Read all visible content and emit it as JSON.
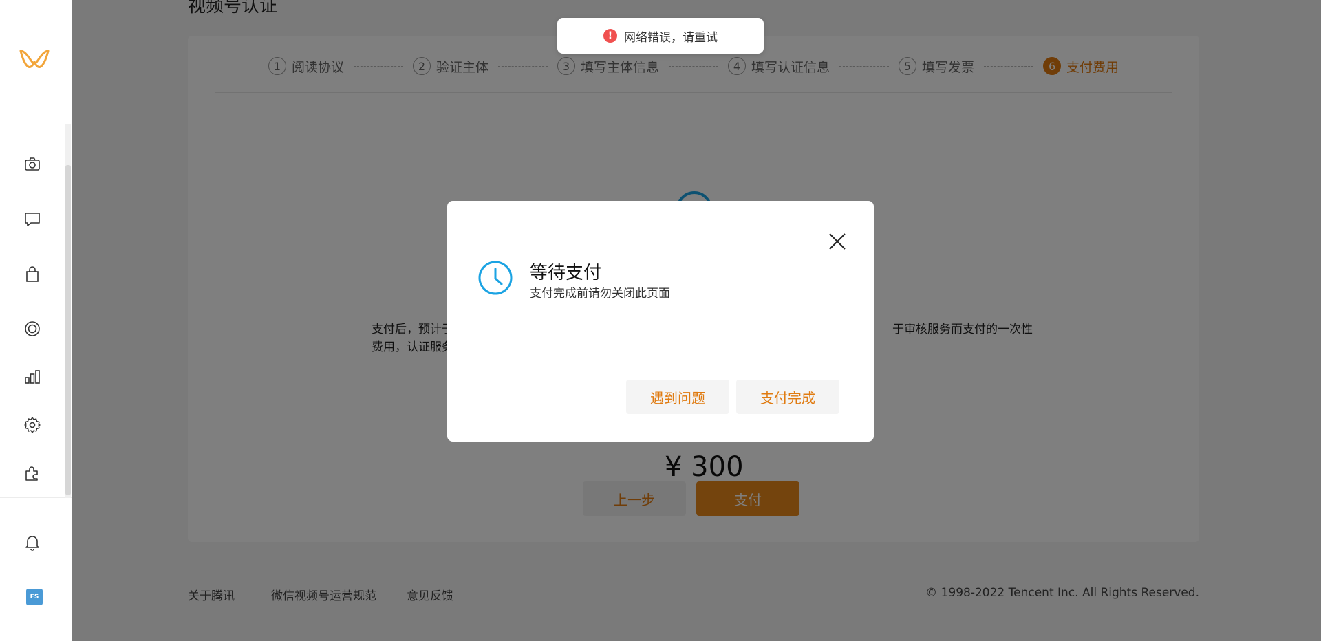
{
  "page": {
    "title": "视频号认证"
  },
  "steps": [
    {
      "num": "1",
      "label": "阅读协议"
    },
    {
      "num": "2",
      "label": "验证主体"
    },
    {
      "num": "3",
      "label": "填写主体信息"
    },
    {
      "num": "4",
      "label": "填写认证信息"
    },
    {
      "num": "5",
      "label": "填写发票"
    },
    {
      "num": "6",
      "label": "支付费用"
    }
  ],
  "content": {
    "desc_left_line1": "支付后，预计于",
    "desc_left_line2": "费用，认证服务",
    "desc_right": "于审核服务而支付的一次性",
    "price": "¥ 300",
    "prev_label": "上一步",
    "pay_label": "支付"
  },
  "toast": {
    "message": "网络错误，请重试",
    "icon": "error-icon"
  },
  "dialog": {
    "title": "等待支付",
    "subtitle": "支付完成前请勿关闭此页面",
    "problem_label": "遇到问题",
    "done_label": "支付完成",
    "icon": "clock-icon"
  },
  "footer": {
    "about": "关于腾讯",
    "rules": "微信视频号运营规范",
    "feedback": "意见反馈",
    "copyright": "© 1998-2022 Tencent Inc. All Rights Reserved."
  },
  "sidebar": {
    "icons": [
      "camera-icon",
      "comment-icon",
      "shopping-bag-icon",
      "live-icon",
      "chart-icon",
      "gear-icon",
      "plugin-icon",
      "bell-icon"
    ],
    "avatar_text": "FS"
  },
  "colors": {
    "accent": "#e07b11",
    "info_blue": "#1ba3e3",
    "error_red": "#f0504f"
  }
}
